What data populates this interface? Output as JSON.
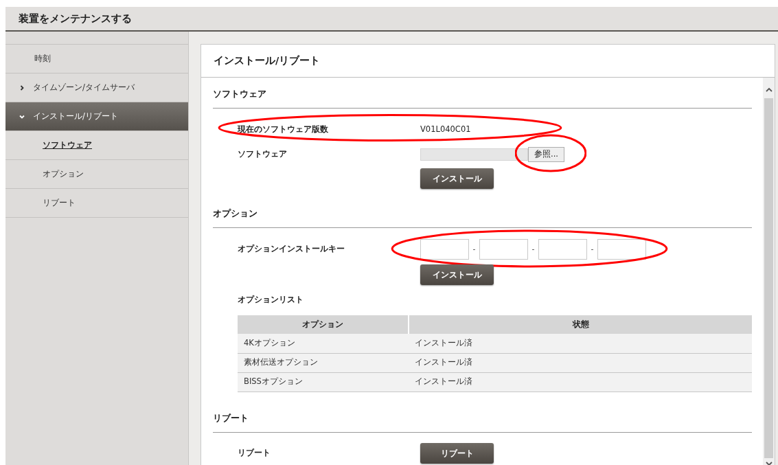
{
  "header": {
    "title": "装置をメンテナンスする"
  },
  "sidebar": {
    "items": [
      {
        "label": "時刻",
        "selected": false
      },
      {
        "label": "タイムゾーン/タイムサーバ",
        "selected": false,
        "expanded": false
      },
      {
        "label": "インストール/リブート",
        "selected": true,
        "expanded": true,
        "children": [
          {
            "label": "ソフトウェア",
            "selected": true
          },
          {
            "label": "オプション",
            "selected": false
          },
          {
            "label": "リブート",
            "selected": false
          }
        ]
      }
    ]
  },
  "panel": {
    "title": "インストール/リブート",
    "software": {
      "heading": "ソフトウェア",
      "version": {
        "label": "現在のソフトウェア版数",
        "value": "V01L040C01",
        "circled": true
      },
      "file": {
        "label": "ソフトウェア",
        "browse": "参照...",
        "circled": true
      },
      "install": "インストール"
    },
    "option": {
      "heading": "オプション",
      "key": {
        "label": "オプションインストールキー",
        "separators": [
          "-",
          "-",
          "-"
        ],
        "circled": true
      },
      "install": "インストール",
      "list_title": "オプションリスト",
      "table": {
        "columns": [
          "オプション",
          "状態"
        ],
        "rows": [
          [
            "4Kオプション",
            "インストール済"
          ],
          [
            "素材伝送オプション",
            "インストール済"
          ],
          [
            "BISSオプション",
            "インストール済"
          ]
        ]
      }
    },
    "reboot": {
      "heading": "リブート",
      "label": "リブート",
      "button": "リブート"
    }
  }
}
